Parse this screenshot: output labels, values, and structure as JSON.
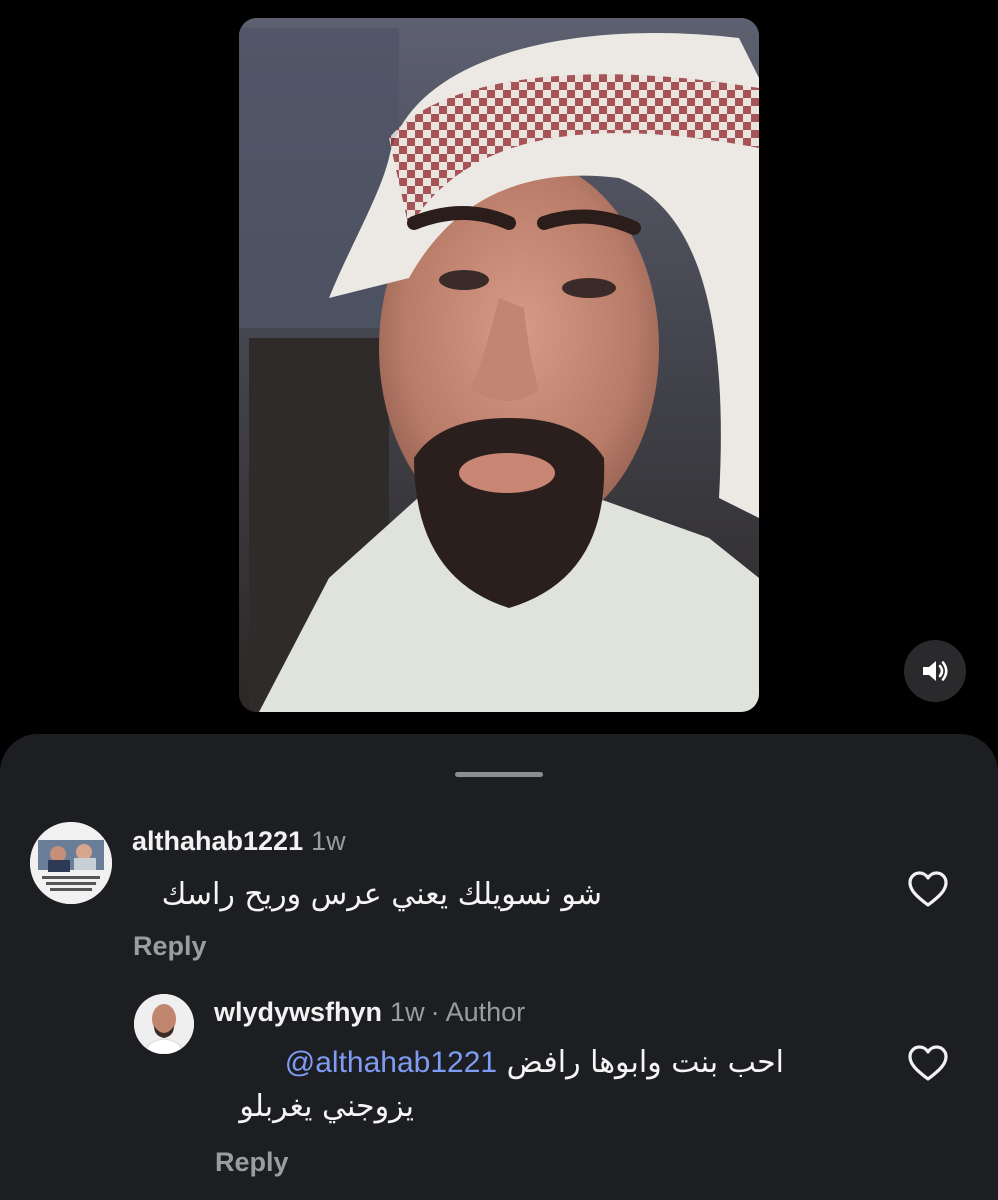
{
  "video": {
    "sound_icon": "speaker-on-icon"
  },
  "comments": [
    {
      "username": "althahab1221",
      "time": "1w",
      "text": "شو نسويلك يعني عرس وريح راسك",
      "reply_label": "Reply",
      "like_icon": "heart-outline-icon"
    }
  ],
  "reply": {
    "username": "wlydywsfhyn",
    "time": "1w",
    "separator": "·",
    "author_label": "Author",
    "mention": "@althahab1221",
    "text_line1": "احب بنت وابوها رافض",
    "text_line2": "يزوجني يغربلو",
    "reply_label": "Reply",
    "like_icon": "heart-outline-icon"
  },
  "colors": {
    "sheet_bg": "#1c1e21",
    "mention": "#7f9cf5",
    "muted": "#9a9ca1"
  }
}
